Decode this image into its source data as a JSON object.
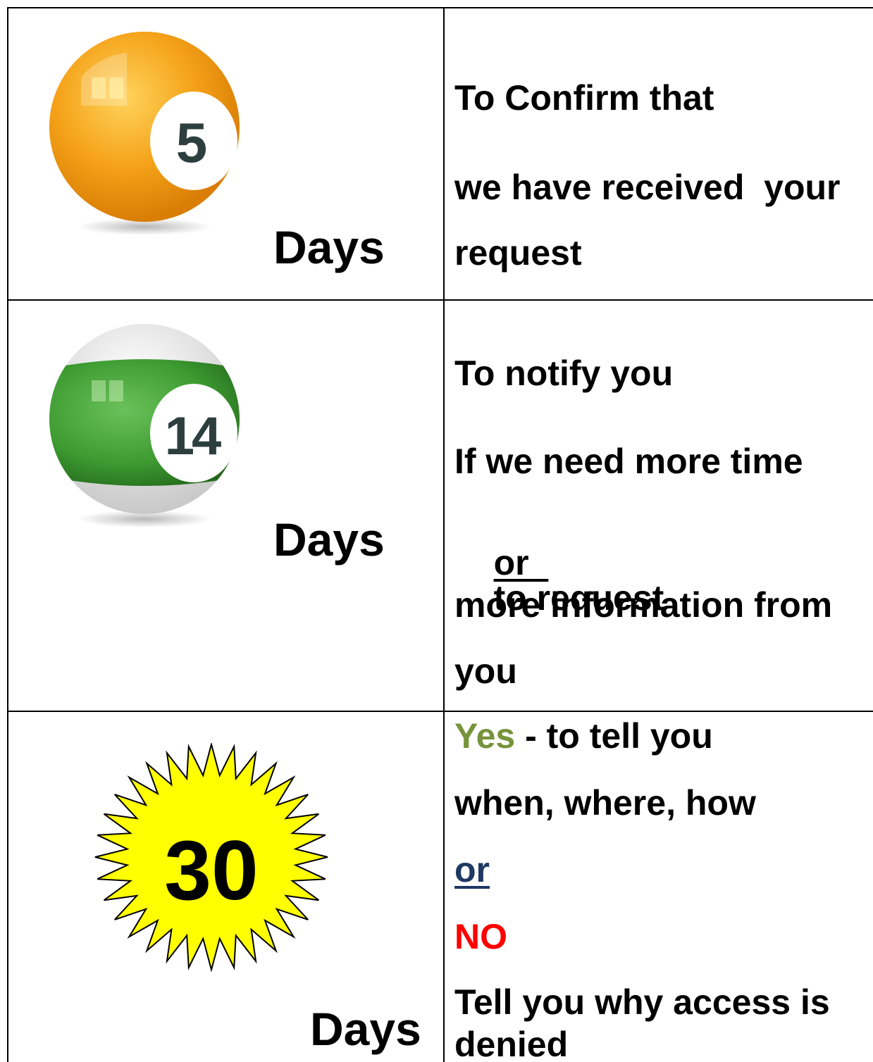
{
  "rows": [
    {
      "badge": {
        "number": "5",
        "color": "#f4a11c",
        "style": "solid-ball-icon"
      },
      "days_label": "Days",
      "lines": [
        "To Confirm that",
        "we have received  your",
        "request"
      ]
    },
    {
      "badge": {
        "number": "14",
        "color": "#3d9b31",
        "style": "striped-ball-icon"
      },
      "days_label": "Days",
      "lines": [
        "To notify you",
        "If we need more time",
        "or",
        "to request",
        "more information from",
        "you"
      ]
    },
    {
      "badge": {
        "number": "30",
        "color": "#ffff00",
        "style": "starburst-icon"
      },
      "days_label": "Days",
      "lines": {
        "yes": "Yes",
        "yes_rest": " - to tell you",
        "when": "when, where, how",
        "or": "or",
        "no": "NO",
        "denied_1": "Tell you why access is",
        "denied_2": "denied"
      }
    }
  ],
  "colors": {
    "yes": "#77933c",
    "or": "#1f3864",
    "no": "#ff0000"
  }
}
